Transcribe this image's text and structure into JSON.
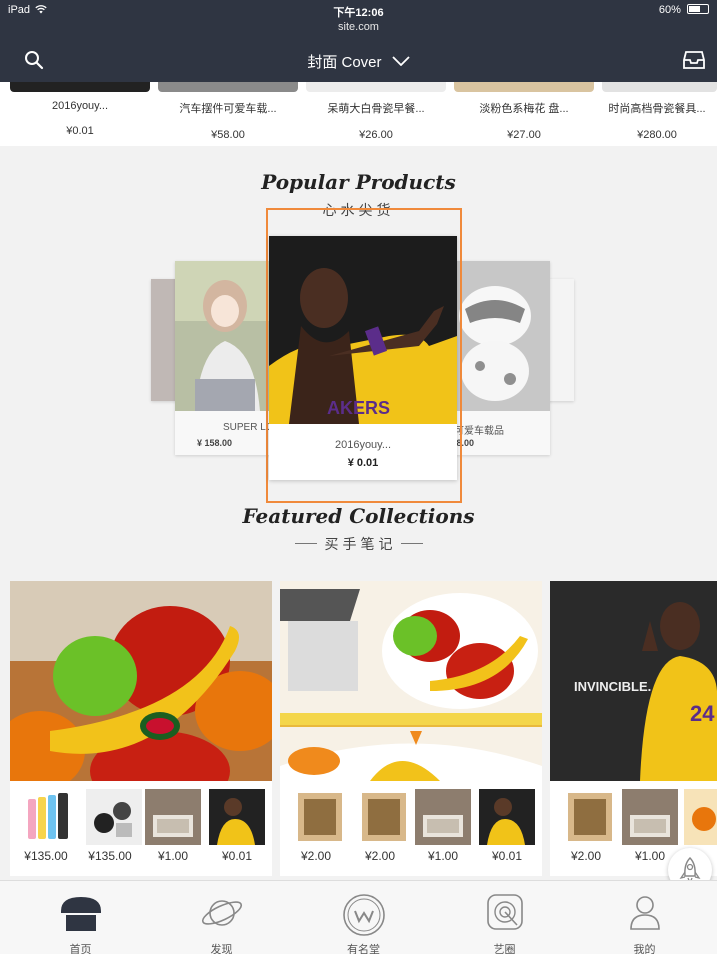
{
  "status_bar": {
    "device": "iPad",
    "time": "下午12:06",
    "url": "site.com",
    "battery": "60%",
    "battery_level": 0.6
  },
  "nav": {
    "title": "封面 Cover"
  },
  "top_strip": [
    {
      "name": "2016youy...",
      "price": "¥0.01"
    },
    {
      "name": "汽车摆件可爱车载...",
      "price": "¥58.00"
    },
    {
      "name": "呆萌大白骨瓷早餐...",
      "price": "¥26.00"
    },
    {
      "name": "淡粉色系梅花 盘...",
      "price": "¥27.00"
    },
    {
      "name": "时尚高档骨瓷餐具...",
      "price": "¥280.00"
    }
  ],
  "popular": {
    "title": "Popular Products",
    "subtitle": "心水尖货",
    "left_card": {
      "name": "SUPER LO",
      "price": "¥ 158.00"
    },
    "center_card": {
      "name": "2016youy...",
      "price": "¥ 0.01"
    },
    "right_card": {
      "name": "件可爱车载品",
      "price": "¥ 58.00"
    }
  },
  "featured": {
    "title": "Featured Collections",
    "subtitle": "买手笔记",
    "collections": [
      {
        "prices": [
          "¥135.00",
          "¥135.00",
          "¥1.00",
          "¥0.01"
        ]
      },
      {
        "prices": [
          "¥2.00",
          "¥2.00",
          "¥1.00",
          "¥0.01"
        ]
      },
      {
        "image_text": "INVINCIBLE.",
        "prices": [
          "¥2.00",
          "¥1.00"
        ]
      }
    ]
  },
  "tabs": [
    {
      "label": "首页",
      "icon": "home-icon"
    },
    {
      "label": "发现",
      "icon": "planet-icon"
    },
    {
      "label": "有名堂",
      "icon": "circle-w-icon"
    },
    {
      "label": "艺圈",
      "icon": "target-icon"
    },
    {
      "label": "我的",
      "icon": "user-icon"
    }
  ],
  "colors": {
    "navbar": "#2f3542",
    "highlight": "#f08a3b",
    "banana": "#f2c21a"
  }
}
